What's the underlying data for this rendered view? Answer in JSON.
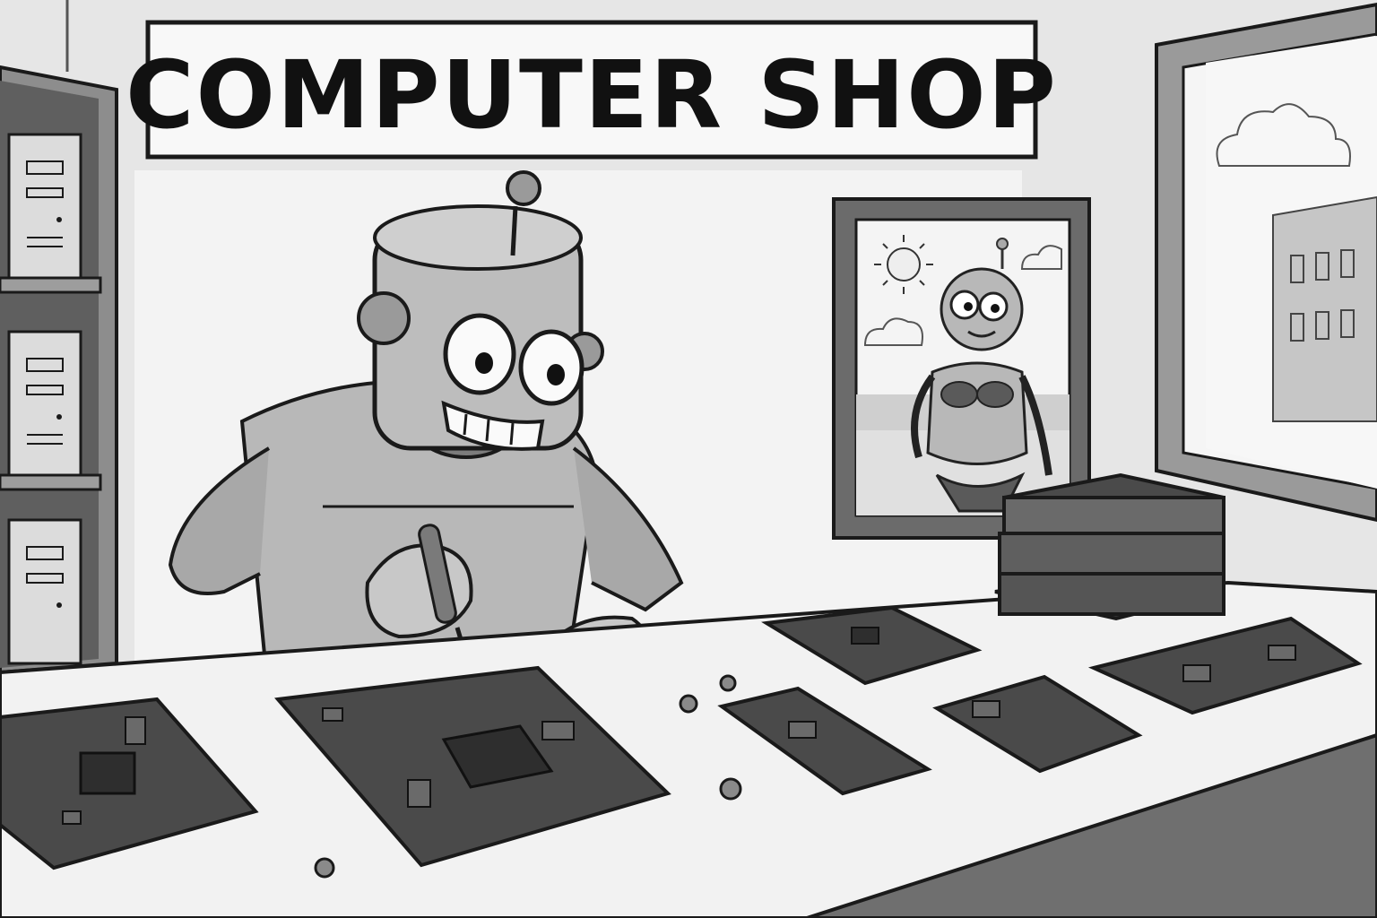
{
  "sign": {
    "text": "COMPUTER SHOP"
  },
  "palette": {
    "ink": "#1a1a1a",
    "wall": "#ebebeb",
    "wall_shadow": "#d4d4d4",
    "counter_top": "#f4f4f4",
    "counter_front": "#8a8a8a",
    "board": "#4a4a4a",
    "robot": "#b8b8b8",
    "sky": "#f7f7f7"
  },
  "icons": [
    "robot-figure",
    "screwdriver-icon",
    "circuit-board-icon",
    "screw-icon",
    "sun-icon",
    "cloud-icon",
    "framed-picture",
    "shelf-computer-case"
  ]
}
